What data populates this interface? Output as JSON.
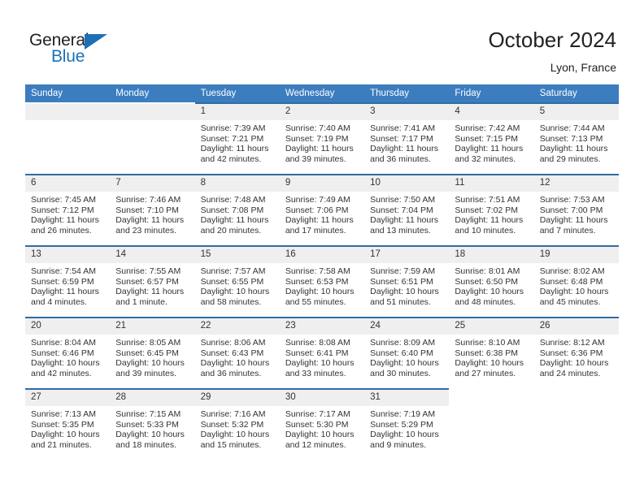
{
  "brand": {
    "name_top": "General",
    "name_bottom": "Blue"
  },
  "header": {
    "title": "October 2024",
    "location": "Lyon, France"
  },
  "colors": {
    "header_blue": "#3b7dbf",
    "cell_top_border": "#2e6da4",
    "daynum_band": "#efefef",
    "logo_blue": "#1a72b8",
    "text": "#333333"
  },
  "weekday_headers": [
    "Sunday",
    "Monday",
    "Tuesday",
    "Wednesday",
    "Thursday",
    "Friday",
    "Saturday"
  ],
  "labels": {
    "sunrise_prefix": "Sunrise: ",
    "sunset_prefix": "Sunset: ",
    "daylight_prefix": "Daylight: "
  },
  "weeks": [
    [
      {
        "day": "",
        "empty": true
      },
      {
        "day": "",
        "empty": true
      },
      {
        "day": "1",
        "sunrise": "Sunrise: 7:39 AM",
        "sunset": "Sunset: 7:21 PM",
        "daylight": "Daylight: 11 hours and 42 minutes."
      },
      {
        "day": "2",
        "sunrise": "Sunrise: 7:40 AM",
        "sunset": "Sunset: 7:19 PM",
        "daylight": "Daylight: 11 hours and 39 minutes."
      },
      {
        "day": "3",
        "sunrise": "Sunrise: 7:41 AM",
        "sunset": "Sunset: 7:17 PM",
        "daylight": "Daylight: 11 hours and 36 minutes."
      },
      {
        "day": "4",
        "sunrise": "Sunrise: 7:42 AM",
        "sunset": "Sunset: 7:15 PM",
        "daylight": "Daylight: 11 hours and 32 minutes."
      },
      {
        "day": "5",
        "sunrise": "Sunrise: 7:44 AM",
        "sunset": "Sunset: 7:13 PM",
        "daylight": "Daylight: 11 hours and 29 minutes."
      }
    ],
    [
      {
        "day": "6",
        "sunrise": "Sunrise: 7:45 AM",
        "sunset": "Sunset: 7:12 PM",
        "daylight": "Daylight: 11 hours and 26 minutes."
      },
      {
        "day": "7",
        "sunrise": "Sunrise: 7:46 AM",
        "sunset": "Sunset: 7:10 PM",
        "daylight": "Daylight: 11 hours and 23 minutes."
      },
      {
        "day": "8",
        "sunrise": "Sunrise: 7:48 AM",
        "sunset": "Sunset: 7:08 PM",
        "daylight": "Daylight: 11 hours and 20 minutes."
      },
      {
        "day": "9",
        "sunrise": "Sunrise: 7:49 AM",
        "sunset": "Sunset: 7:06 PM",
        "daylight": "Daylight: 11 hours and 17 minutes."
      },
      {
        "day": "10",
        "sunrise": "Sunrise: 7:50 AM",
        "sunset": "Sunset: 7:04 PM",
        "daylight": "Daylight: 11 hours and 13 minutes."
      },
      {
        "day": "11",
        "sunrise": "Sunrise: 7:51 AM",
        "sunset": "Sunset: 7:02 PM",
        "daylight": "Daylight: 11 hours and 10 minutes."
      },
      {
        "day": "12",
        "sunrise": "Sunrise: 7:53 AM",
        "sunset": "Sunset: 7:00 PM",
        "daylight": "Daylight: 11 hours and 7 minutes."
      }
    ],
    [
      {
        "day": "13",
        "sunrise": "Sunrise: 7:54 AM",
        "sunset": "Sunset: 6:59 PM",
        "daylight": "Daylight: 11 hours and 4 minutes."
      },
      {
        "day": "14",
        "sunrise": "Sunrise: 7:55 AM",
        "sunset": "Sunset: 6:57 PM",
        "daylight": "Daylight: 11 hours and 1 minute."
      },
      {
        "day": "15",
        "sunrise": "Sunrise: 7:57 AM",
        "sunset": "Sunset: 6:55 PM",
        "daylight": "Daylight: 10 hours and 58 minutes."
      },
      {
        "day": "16",
        "sunrise": "Sunrise: 7:58 AM",
        "sunset": "Sunset: 6:53 PM",
        "daylight": "Daylight: 10 hours and 55 minutes."
      },
      {
        "day": "17",
        "sunrise": "Sunrise: 7:59 AM",
        "sunset": "Sunset: 6:51 PM",
        "daylight": "Daylight: 10 hours and 51 minutes."
      },
      {
        "day": "18",
        "sunrise": "Sunrise: 8:01 AM",
        "sunset": "Sunset: 6:50 PM",
        "daylight": "Daylight: 10 hours and 48 minutes."
      },
      {
        "day": "19",
        "sunrise": "Sunrise: 8:02 AM",
        "sunset": "Sunset: 6:48 PM",
        "daylight": "Daylight: 10 hours and 45 minutes."
      }
    ],
    [
      {
        "day": "20",
        "sunrise": "Sunrise: 8:04 AM",
        "sunset": "Sunset: 6:46 PM",
        "daylight": "Daylight: 10 hours and 42 minutes."
      },
      {
        "day": "21",
        "sunrise": "Sunrise: 8:05 AM",
        "sunset": "Sunset: 6:45 PM",
        "daylight": "Daylight: 10 hours and 39 minutes."
      },
      {
        "day": "22",
        "sunrise": "Sunrise: 8:06 AM",
        "sunset": "Sunset: 6:43 PM",
        "daylight": "Daylight: 10 hours and 36 minutes."
      },
      {
        "day": "23",
        "sunrise": "Sunrise: 8:08 AM",
        "sunset": "Sunset: 6:41 PM",
        "daylight": "Daylight: 10 hours and 33 minutes."
      },
      {
        "day": "24",
        "sunrise": "Sunrise: 8:09 AM",
        "sunset": "Sunset: 6:40 PM",
        "daylight": "Daylight: 10 hours and 30 minutes."
      },
      {
        "day": "25",
        "sunrise": "Sunrise: 8:10 AM",
        "sunset": "Sunset: 6:38 PM",
        "daylight": "Daylight: 10 hours and 27 minutes."
      },
      {
        "day": "26",
        "sunrise": "Sunrise: 8:12 AM",
        "sunset": "Sunset: 6:36 PM",
        "daylight": "Daylight: 10 hours and 24 minutes."
      }
    ],
    [
      {
        "day": "27",
        "sunrise": "Sunrise: 7:13 AM",
        "sunset": "Sunset: 5:35 PM",
        "daylight": "Daylight: 10 hours and 21 minutes."
      },
      {
        "day": "28",
        "sunrise": "Sunrise: 7:15 AM",
        "sunset": "Sunset: 5:33 PM",
        "daylight": "Daylight: 10 hours and 18 minutes."
      },
      {
        "day": "29",
        "sunrise": "Sunrise: 7:16 AM",
        "sunset": "Sunset: 5:32 PM",
        "daylight": "Daylight: 10 hours and 15 minutes."
      },
      {
        "day": "30",
        "sunrise": "Sunrise: 7:17 AM",
        "sunset": "Sunset: 5:30 PM",
        "daylight": "Daylight: 10 hours and 12 minutes."
      },
      {
        "day": "31",
        "sunrise": "Sunrise: 7:19 AM",
        "sunset": "Sunset: 5:29 PM",
        "daylight": "Daylight: 10 hours and 9 minutes."
      },
      {
        "day": "",
        "blank": true
      },
      {
        "day": "",
        "blank": true
      }
    ]
  ]
}
